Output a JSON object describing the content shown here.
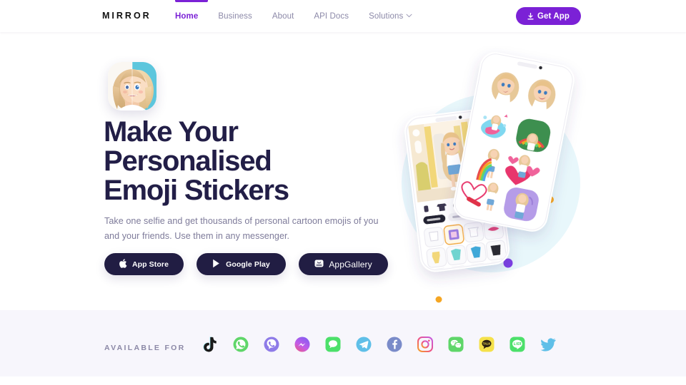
{
  "site": {
    "logo": "MIRROR",
    "accent_color": "#7B21D6",
    "dark_color": "#211D43"
  },
  "header": {
    "nav": [
      {
        "label": "Home",
        "active": true,
        "icon": ""
      },
      {
        "label": "Business",
        "active": false,
        "icon": ""
      },
      {
        "label": "About",
        "active": false,
        "icon": ""
      },
      {
        "label": "API Docs",
        "active": false,
        "icon": ""
      },
      {
        "label": "Solutions",
        "active": false,
        "icon": "chevron-down-icon"
      }
    ],
    "cta": {
      "label": "Get App",
      "icon": "download-arrow-icon"
    }
  },
  "hero": {
    "avatar_alt": "app-icon-split-face-avatar",
    "headline_line1": "Make Your",
    "headline_line2": "Personalised",
    "headline_line3": "Emoji Stickers",
    "subtext": "Take one selfie and get thousands of personal cartoon emojis of you and your friends. Use them in any messenger.",
    "store_buttons": [
      {
        "label": "App Store",
        "icon": "apple-icon"
      },
      {
        "label": "Google Play",
        "icon": "google-play-icon"
      },
      {
        "label": "AppGallery",
        "icon": "appgallery-icon"
      }
    ],
    "illustration": {
      "alt": "two-phone-mockups-avatar-wardrobe-and-sticker-pack",
      "circle_color": "#E8F7FB",
      "dots": [
        {
          "name": "cyan-dot",
          "color": "#35C9DD"
        },
        {
          "name": "purple-dot",
          "color": "#7B3FE4"
        },
        {
          "name": "orange-dot-right",
          "color": "#F5A623"
        },
        {
          "name": "orange-dot-bottom",
          "color": "#F5A623"
        }
      ]
    }
  },
  "available_for": {
    "label": "AVAILABLE FOR",
    "platforms": [
      {
        "name": "tiktok",
        "icon": "tiktok-icon",
        "color": "#111111"
      },
      {
        "name": "whatsapp",
        "icon": "whatsapp-icon",
        "color": "#5FD669"
      },
      {
        "name": "viber",
        "icon": "viber-icon",
        "color": "#8E7BE8"
      },
      {
        "name": "messenger",
        "icon": "messenger-icon",
        "color": "#C25CE8"
      },
      {
        "name": "imessage",
        "icon": "imessage-icon",
        "color": "#4CE06A"
      },
      {
        "name": "telegram",
        "icon": "telegram-icon",
        "color": "#5FBFE8"
      },
      {
        "name": "facebook",
        "icon": "facebook-icon",
        "color": "#7A8BC9"
      },
      {
        "name": "instagram",
        "icon": "instagram-icon",
        "color": "#F06292"
      },
      {
        "name": "wechat",
        "icon": "wechat-icon",
        "color": "#5FD669"
      },
      {
        "name": "kakaotalk",
        "icon": "kakaotalk-icon",
        "color": "#F5E14B"
      },
      {
        "name": "line",
        "icon": "line-icon",
        "color": "#4CE06A"
      },
      {
        "name": "twitter",
        "icon": "twitter-icon",
        "color": "#5FBFE8"
      }
    ]
  }
}
